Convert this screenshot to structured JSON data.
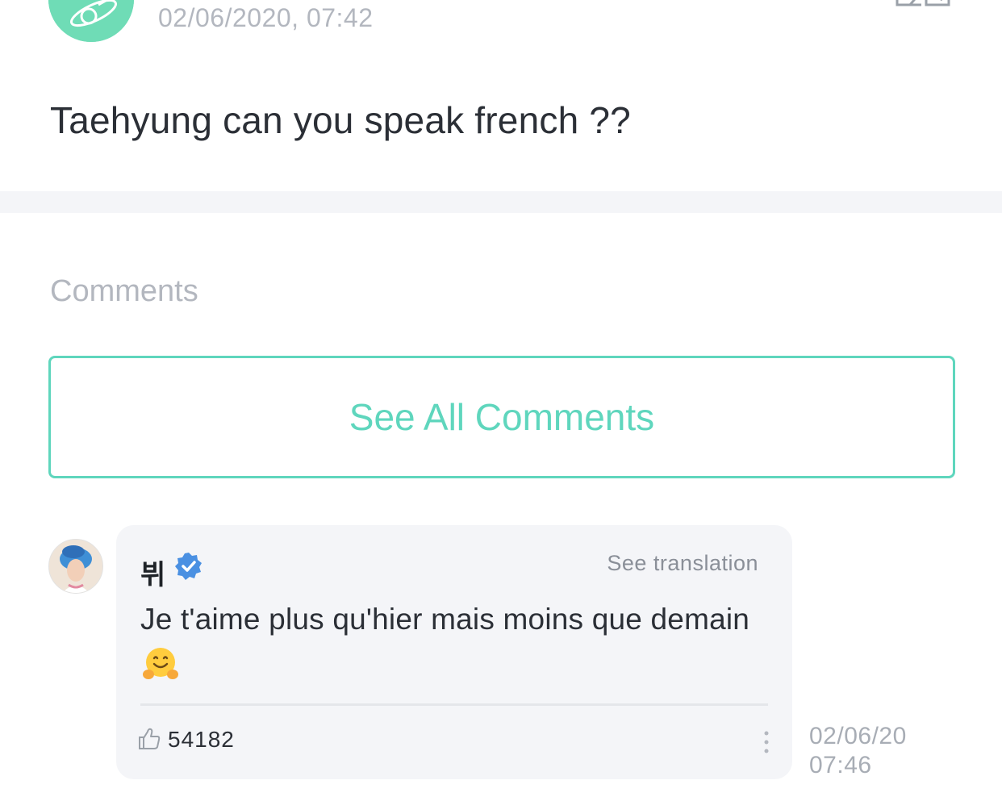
{
  "post": {
    "timestamp": "02/06/2020, 07:42",
    "text": "Taehyung can you speak french ??",
    "avatar_icon": "planet-logo-icon",
    "translate_icon": "translate-icon"
  },
  "comments_section": {
    "heading": "Comments",
    "see_all_label": "See All Comments"
  },
  "comment": {
    "author": "뷔",
    "verified_icon": "verified-badge-icon",
    "see_translation_label": "See translation",
    "text": "Je t'aime plus qu'hier mais moins que demain",
    "emoji_icon": "hugging-face-icon",
    "like_icon": "thumbs-up-icon",
    "like_count": "54182",
    "more_icon": "more-vertical-icon",
    "date": "02/06/20",
    "time": "07:46"
  },
  "colors": {
    "accent": "#5fd6bd",
    "verified": "#4a90e2",
    "muted_text": "#b3b7bf",
    "bubble_bg": "#f4f5f8"
  }
}
